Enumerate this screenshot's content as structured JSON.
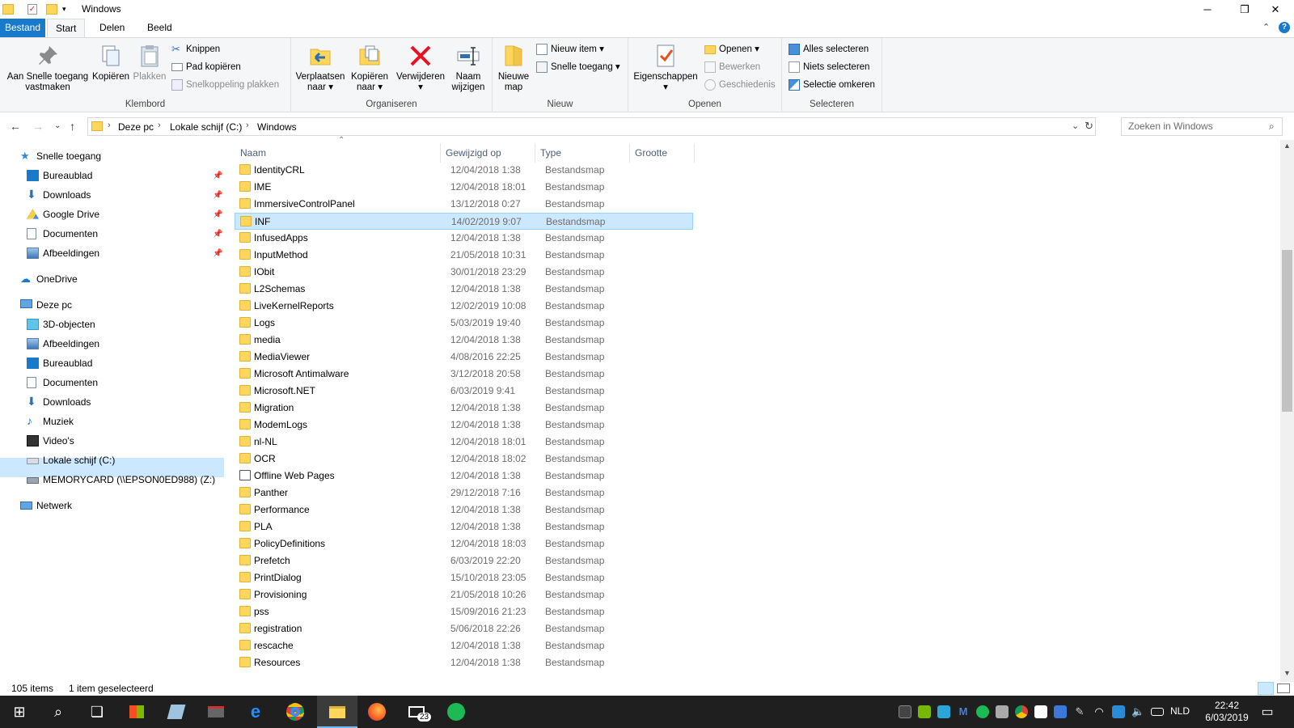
{
  "window": {
    "title": "Windows"
  },
  "ribbon_tabs": {
    "file": "Bestand",
    "start": "Start",
    "share": "Delen",
    "view": "Beeld"
  },
  "ribbon": {
    "clipboard": {
      "label": "Klembord",
      "pin_line1": "Aan Snelle toegang",
      "pin_line2": "vastmaken",
      "copy": "Kopiëren",
      "paste": "Plakken",
      "cut": "Knippen",
      "copy_path": "Pad kopiëren",
      "paste_shortcut": "Snelkoppeling plakken"
    },
    "organize": {
      "label": "Organiseren",
      "move_line1": "Verplaatsen",
      "move_line2": "naar",
      "copyto_line1": "Kopiëren",
      "copyto_line2": "naar",
      "delete": "Verwijderen",
      "rename_line1": "Naam",
      "rename_line2": "wijzigen"
    },
    "new": {
      "label": "Nieuw",
      "folder_line1": "Nieuwe",
      "folder_line2": "map",
      "new_item": "Nieuw item",
      "easy_access": "Snelle toegang"
    },
    "open": {
      "label": "Openen",
      "properties": "Eigenschappen",
      "open": "Openen",
      "edit": "Bewerken",
      "history": "Geschiedenis"
    },
    "select": {
      "label": "Selecteren",
      "all": "Alles selecteren",
      "none": "Niets selecteren",
      "invert": "Selectie omkeren"
    }
  },
  "address": {
    "crumbs": [
      "Deze pc",
      "Lokale schijf (C:)",
      "Windows"
    ],
    "search_placeholder": "Zoeken in Windows"
  },
  "nav": {
    "quick_access": "Snelle toegang",
    "quick_items": [
      "Bureaublad",
      "Downloads",
      "Google Drive",
      "Documenten",
      "Afbeeldingen"
    ],
    "onedrive": "OneDrive",
    "this_pc": "Deze pc",
    "pc_items": [
      "3D-objecten",
      "Afbeeldingen",
      "Bureaublad",
      "Documenten",
      "Downloads",
      "Muziek",
      "Video's",
      "Lokale schijf (C:)",
      "MEMORYCARD (\\\\EPSON0ED988) (Z:)"
    ],
    "network": "Netwerk"
  },
  "columns": {
    "name": "Naam",
    "modified": "Gewijzigd op",
    "type": "Type",
    "size": "Grootte"
  },
  "files": [
    {
      "name": "IdentityCRL",
      "date": "12/04/2018 1:38",
      "type": "Bestandsmap"
    },
    {
      "name": "IME",
      "date": "12/04/2018 18:01",
      "type": "Bestandsmap"
    },
    {
      "name": "ImmersiveControlPanel",
      "date": "13/12/2018 0:27",
      "type": "Bestandsmap"
    },
    {
      "name": "INF",
      "date": "14/02/2019 9:07",
      "type": "Bestandsmap",
      "selected": true
    },
    {
      "name": "InfusedApps",
      "date": "12/04/2018 1:38",
      "type": "Bestandsmap"
    },
    {
      "name": "InputMethod",
      "date": "21/05/2018 10:31",
      "type": "Bestandsmap"
    },
    {
      "name": "IObit",
      "date": "30/01/2018 23:29",
      "type": "Bestandsmap"
    },
    {
      "name": "L2Schemas",
      "date": "12/04/2018 1:38",
      "type": "Bestandsmap"
    },
    {
      "name": "LiveKernelReports",
      "date": "12/02/2019 10:08",
      "type": "Bestandsmap"
    },
    {
      "name": "Logs",
      "date": "5/03/2019 19:40",
      "type": "Bestandsmap"
    },
    {
      "name": "media",
      "date": "12/04/2018 1:38",
      "type": "Bestandsmap"
    },
    {
      "name": "MediaViewer",
      "date": "4/08/2016 22:25",
      "type": "Bestandsmap"
    },
    {
      "name": "Microsoft Antimalware",
      "date": "3/12/2018 20:58",
      "type": "Bestandsmap"
    },
    {
      "name": "Microsoft.NET",
      "date": "6/03/2019 9:41",
      "type": "Bestandsmap"
    },
    {
      "name": "Migration",
      "date": "12/04/2018 1:38",
      "type": "Bestandsmap"
    },
    {
      "name": "ModemLogs",
      "date": "12/04/2018 1:38",
      "type": "Bestandsmap"
    },
    {
      "name": "nl-NL",
      "date": "12/04/2018 18:01",
      "type": "Bestandsmap"
    },
    {
      "name": "OCR",
      "date": "12/04/2018 18:02",
      "type": "Bestandsmap"
    },
    {
      "name": "Offline Web Pages",
      "date": "12/04/2018 1:38",
      "type": "Bestandsmap",
      "special": true
    },
    {
      "name": "Panther",
      "date": "29/12/2018 7:16",
      "type": "Bestandsmap"
    },
    {
      "name": "Performance",
      "date": "12/04/2018 1:38",
      "type": "Bestandsmap"
    },
    {
      "name": "PLA",
      "date": "12/04/2018 1:38",
      "type": "Bestandsmap"
    },
    {
      "name": "PolicyDefinitions",
      "date": "12/04/2018 18:03",
      "type": "Bestandsmap"
    },
    {
      "name": "Prefetch",
      "date": "6/03/2019 22:20",
      "type": "Bestandsmap"
    },
    {
      "name": "PrintDialog",
      "date": "15/10/2018 23:05",
      "type": "Bestandsmap"
    },
    {
      "name": "Provisioning",
      "date": "21/05/2018 10:26",
      "type": "Bestandsmap"
    },
    {
      "name": "pss",
      "date": "15/09/2016 21:23",
      "type": "Bestandsmap"
    },
    {
      "name": "registration",
      "date": "5/06/2018 22:26",
      "type": "Bestandsmap"
    },
    {
      "name": "rescache",
      "date": "12/04/2018 1:38",
      "type": "Bestandsmap"
    },
    {
      "name": "Resources",
      "date": "12/04/2018 1:38",
      "type": "Bestandsmap"
    }
  ],
  "status": {
    "count": "105 items",
    "selected": "1 item geselecteerd"
  },
  "taskbar": {
    "mail_badge": "23",
    "lang": "NLD",
    "time": "22:42",
    "date": "6/03/2019"
  },
  "colors": {
    "accent": "#1979ca",
    "selection": "#cce8ff",
    "folder": "#ffd65c"
  }
}
